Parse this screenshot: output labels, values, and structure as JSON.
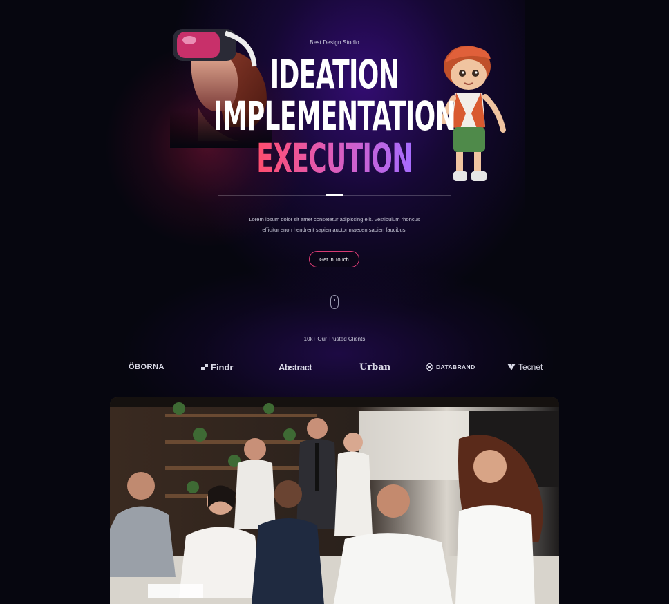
{
  "hero": {
    "eyebrow": "Best Design Studio",
    "line1": "IDEATION",
    "line2": "IMPLEMENTATION",
    "line3": "EXECUTION",
    "description_line1": "Lorem ipsum dolor sit amet consetetur adipiscing elit. Vestibulum rhoncus",
    "description_line2": "efficitur enon hendrerit sapien auctor maecen sapien faucibus.",
    "cta_label": "Get In Touch"
  },
  "clients": {
    "title": "10k+ Our Trusted Clients",
    "logos": [
      "ÖBORNA",
      "Findr",
      "Abstract",
      "Urban",
      "DATABRAND",
      "Tecnet"
    ]
  },
  "colors": {
    "background": "#06060f",
    "accent_pink": "#ff4d6d",
    "accent_purple": "#a66cff",
    "cta_border": "#d83b73"
  },
  "icons": {
    "scroll": "mouse-scroll-icon",
    "findr": "findr-logo-mark",
    "databrand": "databrand-logo-mark",
    "tecnet": "tecnet-logo-mark"
  }
}
